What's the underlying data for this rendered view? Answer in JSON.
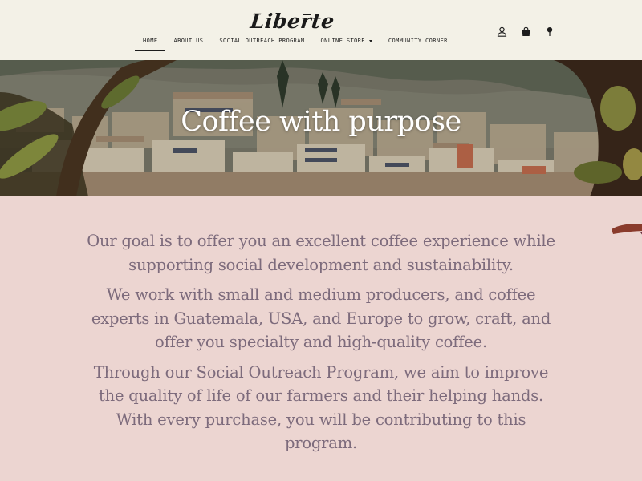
{
  "brand": {
    "logo_text": "Liberte",
    "logo_alt": "Liberté"
  },
  "nav": {
    "items": [
      {
        "label": "HOME",
        "active": true
      },
      {
        "label": "ABOUT US",
        "active": false
      },
      {
        "label": "SOCIAL OUTREACH PROGRAM",
        "active": false
      },
      {
        "label": "ONLINE STORE",
        "active": false,
        "dropdown": true
      },
      {
        "label": "COMMUNITY CORNER",
        "active": false
      }
    ]
  },
  "header_icons": [
    "user-icon",
    "shopping-bag-icon",
    "location-pin-icon"
  ],
  "hero": {
    "title": "Coffee with purpose"
  },
  "content": {
    "paragraphs": [
      "Our goal is to offer you an excellent coffee experience while supporting social development and sustainability.",
      "We work with small and medium producers, and coffee experts in Guatemala, USA, and Europe to grow, craft, and offer you specialty and high-quality coffee.",
      "Through our Social Outreach Program, we aim to improve the quality of life of our farmers and their helping hands. With every purchase, you will be contributing to this program."
    ]
  },
  "colors": {
    "header_bg": "#f3f1e7",
    "page_bg": "#ecd5d1",
    "body_text": "#7d6b7c",
    "nav_text": "#1d1d1d",
    "accent_brush": "#8a3b2c"
  }
}
